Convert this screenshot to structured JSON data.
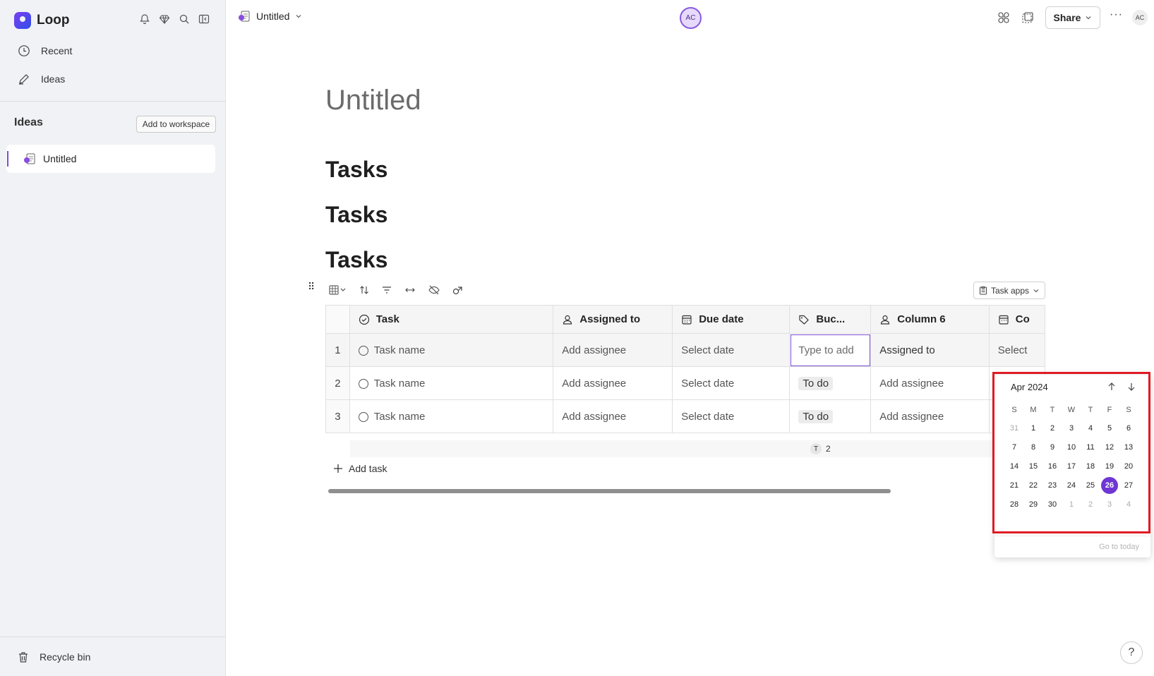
{
  "app": {
    "name": "Loop"
  },
  "sidebar": {
    "nav": [
      {
        "label": "Recent",
        "icon": "clock-icon"
      },
      {
        "label": "Ideas",
        "icon": "pencil-icon"
      }
    ],
    "section_title": "Ideas",
    "add_workspace_label": "Add to workspace",
    "pages": [
      {
        "label": "Untitled"
      }
    ],
    "recycle_label": "Recycle bin"
  },
  "topbar": {
    "doc_title": "Untitled",
    "collaborator_initials": "AC",
    "share_label": "Share",
    "more_label": "···",
    "user_initials": "AC"
  },
  "document": {
    "title": "Untitled",
    "headings": [
      "Tasks",
      "Tasks",
      "Tasks"
    ]
  },
  "table": {
    "task_apps_label": "Task apps",
    "columns": [
      {
        "label": "Task",
        "icon": "check-circle-icon"
      },
      {
        "label": "Assigned to",
        "icon": "person-icon"
      },
      {
        "label": "Due date",
        "icon": "calendar-icon"
      },
      {
        "label": "Buc...",
        "icon": "tag-icon"
      },
      {
        "label": "Column 6",
        "icon": "person-icon"
      },
      {
        "label": "Co",
        "icon": "calendar-icon"
      }
    ],
    "rows": [
      {
        "num": "1",
        "task": "Task name",
        "assignee": "Add assignee",
        "due": "Select date",
        "bucket": "Type to add",
        "col6": "Assigned to",
        "col7": "Select"
      },
      {
        "num": "2",
        "task": "Task name",
        "assignee": "Add assignee",
        "due": "Select date",
        "bucket": "To do",
        "col6": "Add assignee",
        "col7": ""
      },
      {
        "num": "3",
        "task": "Task name",
        "assignee": "Add assignee",
        "due": "Select date",
        "bucket": "To do",
        "col6": "Add assignee",
        "col7": ""
      }
    ],
    "summary_badge": "T",
    "summary_count": "2",
    "add_task_label": "Add task"
  },
  "datepicker": {
    "month_label": "Apr 2024",
    "weekdays": [
      "S",
      "M",
      "T",
      "W",
      "T",
      "F",
      "S"
    ],
    "weeks": [
      [
        "31",
        "1",
        "2",
        "3",
        "4",
        "5",
        "6"
      ],
      [
        "7",
        "8",
        "9",
        "10",
        "11",
        "12",
        "13"
      ],
      [
        "14",
        "15",
        "16",
        "17",
        "18",
        "19",
        "20"
      ],
      [
        "21",
        "22",
        "23",
        "24",
        "25",
        "26",
        "27"
      ],
      [
        "28",
        "29",
        "30",
        "1",
        "2",
        "3",
        "4"
      ]
    ],
    "selected": "26",
    "goto_today_label": "Go to today",
    "highlight_color": "#e01b24",
    "accent_color": "#6e36d4"
  },
  "help_label": "?"
}
